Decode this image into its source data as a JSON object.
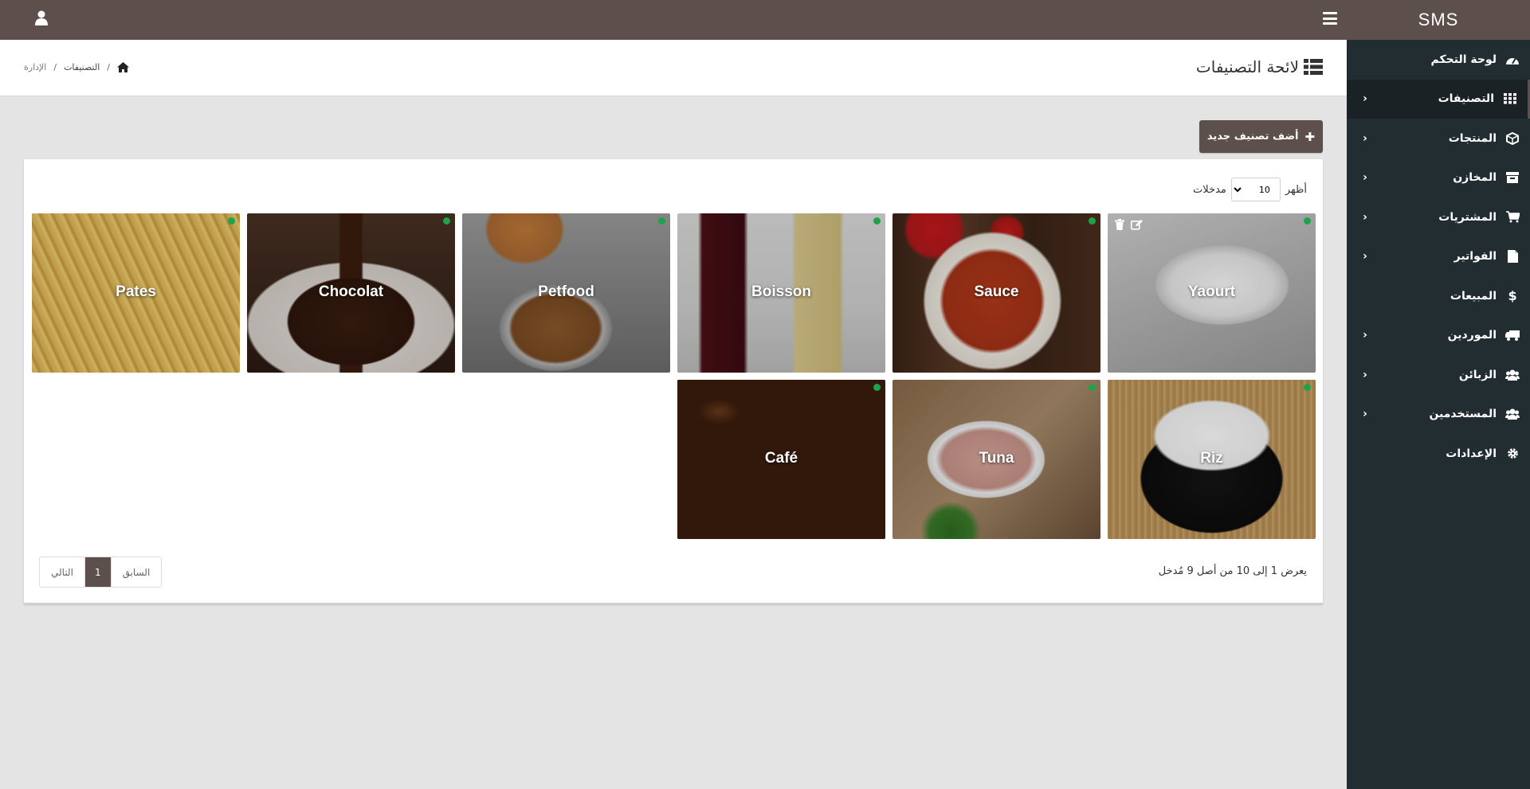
{
  "app": {
    "brand": "SMS"
  },
  "sidebar": {
    "items": [
      {
        "label": "لوحة التحكم",
        "icon": "dashboard-icon",
        "has_submenu": false,
        "active": false
      },
      {
        "label": "التصنيفات",
        "icon": "grid-icon",
        "has_submenu": true,
        "active": true
      },
      {
        "label": "المنتجات",
        "icon": "cube-icon",
        "has_submenu": true,
        "active": false
      },
      {
        "label": "المخازن",
        "icon": "archive-icon",
        "has_submenu": true,
        "active": false
      },
      {
        "label": "المشتريات",
        "icon": "shopping-cart-icon",
        "has_submenu": true,
        "active": false
      },
      {
        "label": "الفواتير",
        "icon": "file-icon",
        "has_submenu": true,
        "active": false
      },
      {
        "label": "المبيعات",
        "icon": "dollar-icon",
        "has_submenu": false,
        "active": false
      },
      {
        "label": "الموردين",
        "icon": "truck-icon",
        "has_submenu": true,
        "active": false
      },
      {
        "label": "الزبائن",
        "icon": "users-icon",
        "has_submenu": true,
        "active": false
      },
      {
        "label": "المستخدمين",
        "icon": "users-icon",
        "has_submenu": true,
        "active": false
      },
      {
        "label": "الإعدادات",
        "icon": "gear-icon",
        "has_submenu": false,
        "active": false
      }
    ]
  },
  "header": {
    "title": "لائحة التصنيفات",
    "breadcrumb": [
      "التصنيفات",
      "الإدارة"
    ]
  },
  "toolbar": {
    "add_label": "أضف تصنيف جديد"
  },
  "table": {
    "show_label": "أظهر",
    "entries_label": "مدخلات",
    "page_length": "10",
    "info": "يعرض 1 إلى 10 من أصل 9 مُدخل"
  },
  "categories": [
    {
      "name": "Yaourt",
      "status_color": "#1fa34a",
      "actions_visible": true
    },
    {
      "name": "Sauce",
      "status_color": "#1fa34a"
    },
    {
      "name": "Boisson",
      "status_color": "#1fa34a"
    },
    {
      "name": "Petfood",
      "status_color": "#1fa34a"
    },
    {
      "name": "Chocolat",
      "status_color": "#1fa34a"
    },
    {
      "name": "Pates",
      "status_color": "#1fa34a"
    },
    {
      "name": "Riz",
      "status_color": "#1fa34a"
    },
    {
      "name": "Tuna",
      "status_color": "#1fa34a"
    },
    {
      "name": "Café",
      "status_color": "#1fa34a"
    }
  ],
  "pagination": {
    "prev": "السابق",
    "current": "1",
    "next": "التالي"
  },
  "colors": {
    "primary": "#5d504c",
    "sidebar": "#222d32",
    "active_dot": "#1fa34a"
  }
}
